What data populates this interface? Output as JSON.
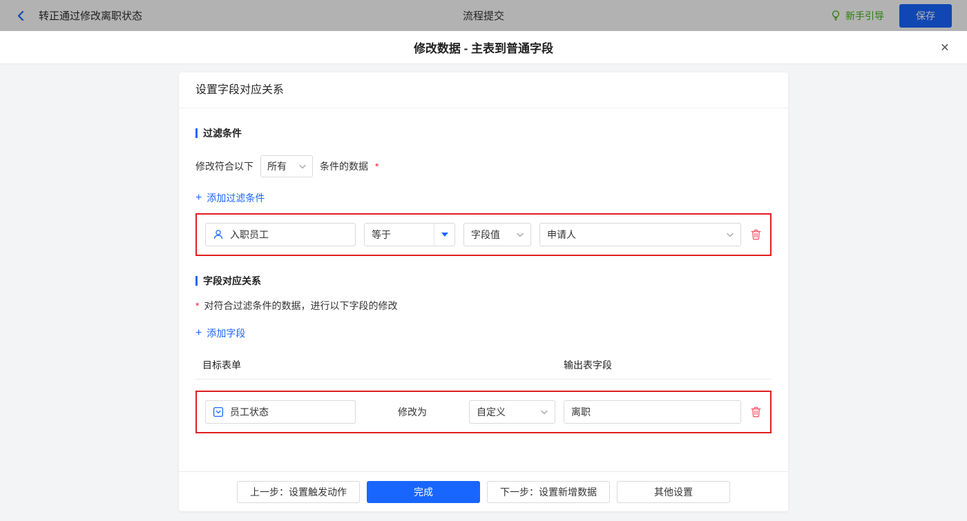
{
  "topbar": {
    "title": "转正通过修改离职状态",
    "center_title": "流程提交",
    "guide_label": "新手引导",
    "save_label": "保存"
  },
  "modal": {
    "title": "修改数据 - 主表到普通字段",
    "close_glyph": "×"
  },
  "icons": {
    "plus": "+"
  },
  "card": {
    "header": "设置字段对应关系",
    "filter_section": {
      "title": "过滤条件",
      "match_prefix": "修改符合以下",
      "match_select_value": "所有",
      "match_suffix": "条件的数据",
      "required_mark": "*",
      "add_link_label": "添加过滤条件",
      "row": {
        "field": "入职员工",
        "field_icon": "user-icon",
        "operator": "等于",
        "value_type": "字段值",
        "value": "申请人"
      }
    },
    "mapping_section": {
      "title": "字段对应关系",
      "required_mark": "*",
      "description": "对符合过滤条件的数据，进行以下字段的修改",
      "add_link_label": "添加字段",
      "col_target": "目标表单",
      "col_output": "输出表字段",
      "row": {
        "field": "员工状态",
        "field_icon": "select-field-icon",
        "action_label": "修改为",
        "mode": "自定义",
        "value": "离职"
      }
    },
    "footer": {
      "prev_label": "上一步：设置触发动作",
      "done_label": "完成",
      "next_label": "下一步：设置新增数据",
      "other_label": "其他设置"
    }
  },
  "colors": {
    "accent_blue": "#1966ff",
    "highlight_red": "#e01f1f",
    "trash_red": "#f5586a",
    "guide_green": "#3eb312",
    "asterisk_red": "#f5222d"
  }
}
